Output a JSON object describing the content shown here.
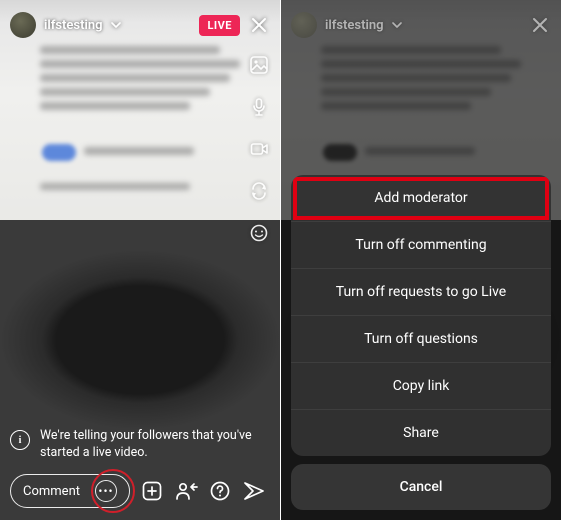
{
  "header": {
    "username": "ilfstesting",
    "live_label": "LIVE"
  },
  "notice": {
    "text": "We're telling your followers that you've started a live video."
  },
  "bottom": {
    "comment_placeholder": "Comment"
  },
  "sheet": {
    "items": [
      "Add moderator",
      "Turn off commenting",
      "Turn off requests to go Live",
      "Turn off questions",
      "Copy link",
      "Share"
    ],
    "cancel": "Cancel"
  },
  "colors": {
    "live_badge": "#ed2656",
    "highlight_red": "#e00012",
    "circle_red": "#d01f2a"
  }
}
